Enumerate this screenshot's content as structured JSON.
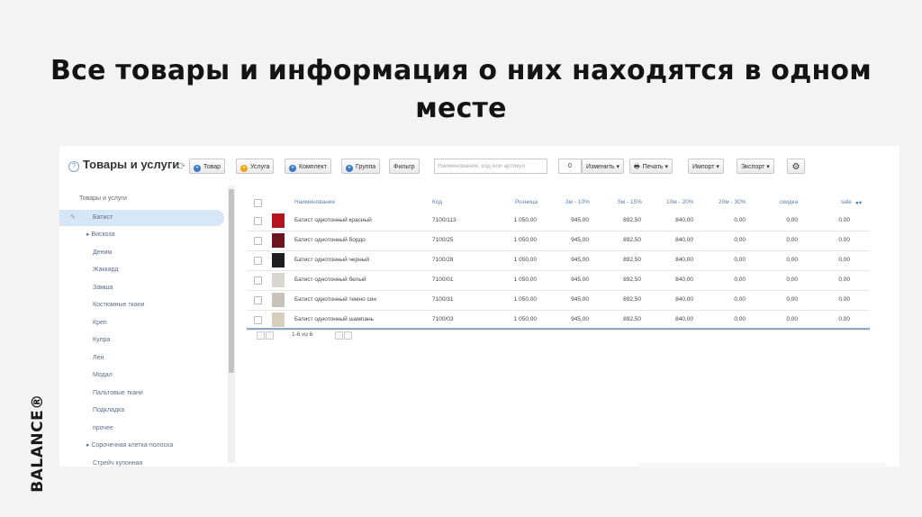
{
  "slide": {
    "title": "Все товары и информация о них находятся в одном месте",
    "brand": "BALANCE®"
  },
  "app": {
    "title": "Товары и услуги",
    "toolbar": {
      "btn_product": "Товар",
      "btn_service": "Услуга",
      "btn_kit": "Комплект",
      "btn_group": "Группа",
      "btn_filter": "Фильтр",
      "search_placeholder": "Наименование, код или артикул",
      "selected_count": "0",
      "btn_change": "Изменить ▾",
      "btn_print": "Печать ▾",
      "btn_import": "Импорт ▾",
      "btn_export": "Экспорт ▾"
    },
    "sidebar": {
      "root": "Товары и услуги",
      "items": [
        {
          "label": "Батист",
          "active": true
        },
        {
          "label": "▸ Вискоза"
        },
        {
          "label": "Деним"
        },
        {
          "label": "Жаккард"
        },
        {
          "label": "Замша"
        },
        {
          "label": "Костюмные ткани"
        },
        {
          "label": "Креп"
        },
        {
          "label": "Кулра"
        },
        {
          "label": "Лен"
        },
        {
          "label": "Модал"
        },
        {
          "label": "Пальтовые ткани"
        },
        {
          "label": "Подкладка"
        },
        {
          "label": "прочее"
        },
        {
          "label": "▸ Сорочечная клетка-полоска"
        },
        {
          "label": "Стрейч купонная"
        }
      ]
    },
    "grid": {
      "columns": [
        "Наименование",
        "Код",
        "Розница",
        "3м - 10%",
        "5м - 15%",
        "10м - 20%",
        "20м - 30%",
        "скидка",
        "sale"
      ],
      "rows": [
        {
          "thumb": "#b5161e",
          "name": "Батист однотонный красный",
          "code": "7100/113",
          "retail": "1 050,00",
          "p1": "945,00",
          "p2": "892,50",
          "p3": "840,00",
          "p4": "0,00",
          "disc": "0,00",
          "sale": "0,00"
        },
        {
          "thumb": "#6b1420",
          "name": "Батист однотонный бордо",
          "code": "7100/25",
          "retail": "1 050,00",
          "p1": "945,00",
          "p2": "892,50",
          "p3": "840,00",
          "p4": "0,00",
          "disc": "0,00",
          "sale": "0,00"
        },
        {
          "thumb": "#1d1d22",
          "name": "Батист однотонный черный",
          "code": "7100/28",
          "retail": "1 050,00",
          "p1": "945,00",
          "p2": "892,50",
          "p3": "840,00",
          "p4": "0,00",
          "disc": "0,00",
          "sale": "0,00"
        },
        {
          "thumb": "#d8d6d0",
          "name": "Батист однотонный белый",
          "code": "7100/01",
          "retail": "1 050,00",
          "p1": "945,00",
          "p2": "892,50",
          "p3": "840,00",
          "p4": "0,00",
          "disc": "0,00",
          "sale": "0,00"
        },
        {
          "thumb": "#c9c2b8",
          "name": "Батист однотонный темно син",
          "code": "7100/31",
          "retail": "1 050,00",
          "p1": "945,00",
          "p2": "892,50",
          "p3": "840,00",
          "p4": "0,00",
          "disc": "0,00",
          "sale": "0,00"
        },
        {
          "thumb": "#d6cdbd",
          "name": "Батист однотонный шампань",
          "code": "7100/03",
          "retail": "1 050,00",
          "p1": "945,00",
          "p2": "892,50",
          "p3": "840,00",
          "p4": "0,00",
          "disc": "0,00",
          "sale": "0,00"
        }
      ],
      "pager_text": "1-6 из 6"
    }
  }
}
